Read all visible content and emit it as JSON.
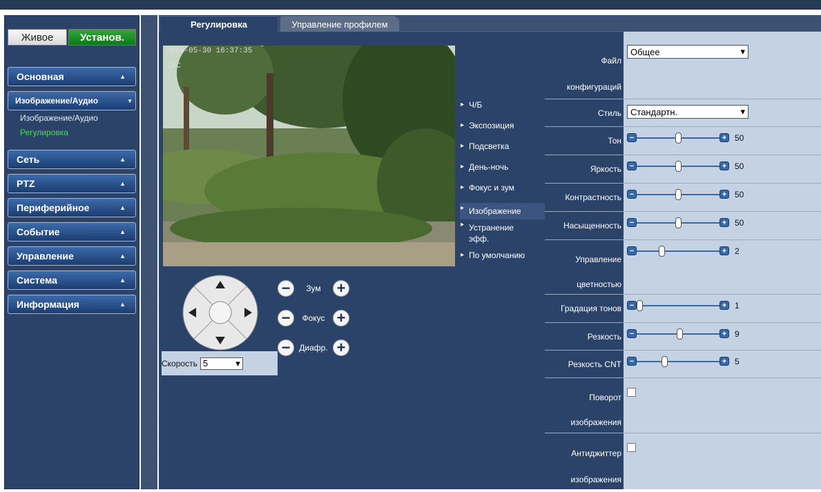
{
  "mode": {
    "live": "Живое",
    "setup": "Установ."
  },
  "nav": {
    "basic": "Основная",
    "image_audio": "Изображение/Аудио",
    "sub_image_audio": "Изображение/Аудио",
    "sub_adjust": "Регулировка",
    "network": "Сеть",
    "ptz": "PTZ",
    "peripheral": "Периферийное",
    "event": "Событие",
    "management": "Управление",
    "system": "Система",
    "info": "Информация"
  },
  "tabs": {
    "adjust": "Регулировка",
    "profile": "Управление профилем"
  },
  "video": {
    "timestamp": "2014-05-30 16:37:35",
    "channel": "IPC"
  },
  "image_menu": [
    "Ч/Б",
    "Экспозиция",
    "Подсветка",
    "День-ночь",
    "Фокус и зум",
    "Изображение",
    "Устранение эфф.",
    "По умолчанию"
  ],
  "ptz": {
    "zoom": "Зум",
    "focus": "Фокус",
    "iris": "Диафр.",
    "speed_label": "Скорость",
    "speed_value": "5"
  },
  "settings": {
    "config_file_label": "Файл конфигураций",
    "config_file_value": "Общее",
    "style_label": "Стиль",
    "style_value": "Стандартн.",
    "hue_label": "Тон",
    "hue_value": "50",
    "brightness_label": "Яркость",
    "brightness_value": "50",
    "contrast_label": "Контрастность",
    "contrast_value": "50",
    "saturation_label": "Насыщенность",
    "saturation_value": "50",
    "color_control_label": "Управление цветностью",
    "color_control_value": "2",
    "gamma_label": "Градация тонов",
    "gamma_value": "1",
    "sharpness_label": "Резкость",
    "sharpness_value": "9",
    "sharpness_cnt_label": "Резкость CNT",
    "sharpness_cnt_value": "5",
    "rotate_label": "Поворот изображения",
    "antijitter_label": "Антиджиттер изображения"
  },
  "slider_levels": {
    "hue": 0.5,
    "brightness": 0.5,
    "contrast": 0.5,
    "saturation": 0.5,
    "color_control": 0.29,
    "gamma": 0.0,
    "sharpness": 0.52,
    "sharpness_cnt": 0.32
  },
  "colors": {
    "panel": "#2c4369",
    "light_panel": "#c4d2e3",
    "active_green": "#48e04c",
    "setup_green": "#0a7a16"
  }
}
